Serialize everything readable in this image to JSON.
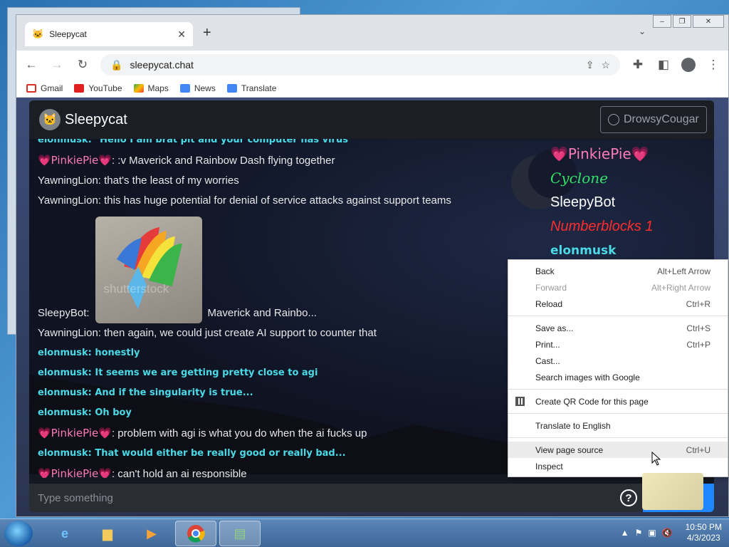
{
  "browser": {
    "tab_title": "Sleepycat",
    "tab_close": "✕",
    "new_tab": "+",
    "url": "sleepycat.chat",
    "bookmarks": [
      "Gmail",
      "YouTube",
      "Maps",
      "News",
      "Translate"
    ]
  },
  "app": {
    "title": "Sleepycat",
    "current_user": "DrowsyCougar",
    "input_placeholder": "Type something",
    "help_label": "?",
    "send_label": "➤"
  },
  "messages": {
    "m0": "elonmusk: \"Hello I am brat pit and your computer has virus\"",
    "m1_user": "💗PinkiePie💗",
    "m1_text": ": :v Maverick and Rainbow Dash flying together",
    "m2": "YawningLion: that's the least of my worries",
    "m3": "YawningLion: this has huge potential for denial of service attacks against support teams",
    "m4_user": "SleepyBot:",
    "m4_text": "Maverick and Rainbo...",
    "m4_watermark": "shutterstock",
    "m5": "YawningLion: then again, we could just create AI support to counter that",
    "m6": "elonmusk: honestly",
    "m7": "elonmusk: It seems we are getting pretty close to agi",
    "m8": "elonmusk: And if the singularity is true...",
    "m9": "elonmusk: Oh boy",
    "m10_user": "💗PinkiePie💗",
    "m10_text": ": problem with agi is what you do when the ai fucks up",
    "m11": "elonmusk: That would either be really good or really bad...",
    "m12_user": "💗PinkiePie💗",
    "m12_text": ": can't hold an ai responsible"
  },
  "users": [
    "💗PinkiePie💗",
    "Cyclone",
    "SleepyBot",
    "Numberblocks 1",
    "elonmusk"
  ],
  "context_menu": {
    "back": "Back",
    "back_sc": "Alt+Left Arrow",
    "forward": "Forward",
    "forward_sc": "Alt+Right Arrow",
    "reload": "Reload",
    "reload_sc": "Ctrl+R",
    "save": "Save as...",
    "save_sc": "Ctrl+S",
    "print": "Print...",
    "print_sc": "Ctrl+P",
    "cast": "Cast...",
    "search_images": "Search images with Google",
    "qr": "Create QR Code for this page",
    "translate": "Translate to English",
    "view_source": "View page source",
    "view_source_sc": "Ctrl+U",
    "inspect": "Inspect"
  },
  "taskbar": {
    "time": "10:50 PM",
    "date": "4/3/2023"
  }
}
